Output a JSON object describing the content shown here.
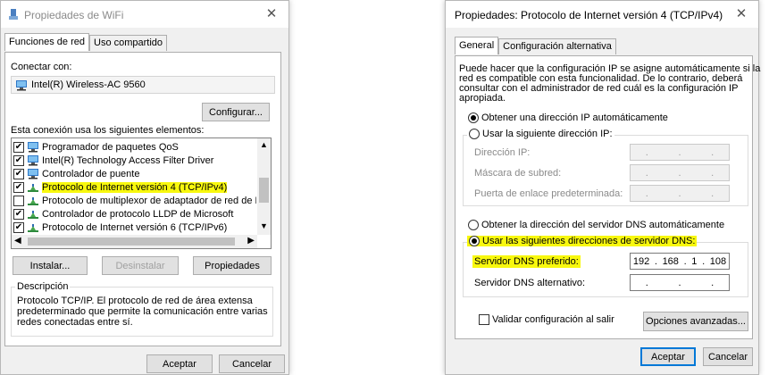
{
  "wifi": {
    "title": "Propiedades de WiFi",
    "tabs": [
      "Funciones de red",
      "Uso compartido"
    ],
    "connect_label": "Conectar con:",
    "adapter_name": "Intel(R) Wireless-AC 9560",
    "configure_btn": "Configurar...",
    "items_label": "Esta conexión usa los siguientes elementos:",
    "items": [
      {
        "label": "Programador de paquetes QoS",
        "checked": true
      },
      {
        "label": "Intel(R) Technology Access Filter Driver",
        "checked": true
      },
      {
        "label": "Controlador de puente",
        "checked": true
      },
      {
        "label": "Protocolo de Internet versión 4 (TCP/IPv4)",
        "checked": true
      },
      {
        "label": "Protocolo de multiplexor de adaptador de red de Micros",
        "checked": false
      },
      {
        "label": "Controlador de protocolo LLDP de Microsoft",
        "checked": true
      },
      {
        "label": "Protocolo de Internet versión 6 (TCP/IPv6)",
        "checked": true
      }
    ],
    "install_btn": "Instalar...",
    "uninstall_btn": "Desinstalar",
    "properties_btn": "Propiedades",
    "description_label": "Descripción",
    "description_text": [
      "Protocolo TCP/IP. El protocolo de red de área extensa",
      "predeterminado que permite la comunicación entre varias",
      "redes conectadas entre sí."
    ],
    "accept_btn": "Aceptar",
    "cancel_btn": "Cancelar"
  },
  "ipv4": {
    "title": "Propiedades: Protocolo de Internet versión 4 (TCP/IPv4)",
    "tabs": [
      "General",
      "Configuración alternativa"
    ],
    "intro": [
      "Puede hacer que la configuración IP se asigne automáticamente si la",
      "red es compatible con esta funcionalidad. De lo contrario, deberá",
      "consultar con el administrador de red cuál es la configuración IP",
      "apropiada."
    ],
    "auto_ip": "Obtener una dirección IP automáticamente",
    "manual_ip": "Usar la siguiente dirección IP:",
    "ip_label": "Dirección IP:",
    "mask_label": "Máscara de subred:",
    "gateway_label": "Puerta de enlace predeterminada:",
    "empty_ip": [
      ".",
      ".",
      "."
    ],
    "auto_dns": "Obtener la dirección del servidor DNS automáticamente",
    "manual_dns": "Usar las siguientes direcciones de servidor DNS:",
    "preferred_dns_label": "Servidor DNS preferido:",
    "preferred_dns": [
      "192",
      ".",
      "168",
      ".",
      "1",
      ".",
      "108"
    ],
    "alternate_dns_label": "Servidor DNS alternativo:",
    "validate_label": "Validar configuración al salir",
    "advanced_btn": "Opciones avanzadas...",
    "accept_btn": "Aceptar",
    "cancel_btn": "Cancelar"
  }
}
